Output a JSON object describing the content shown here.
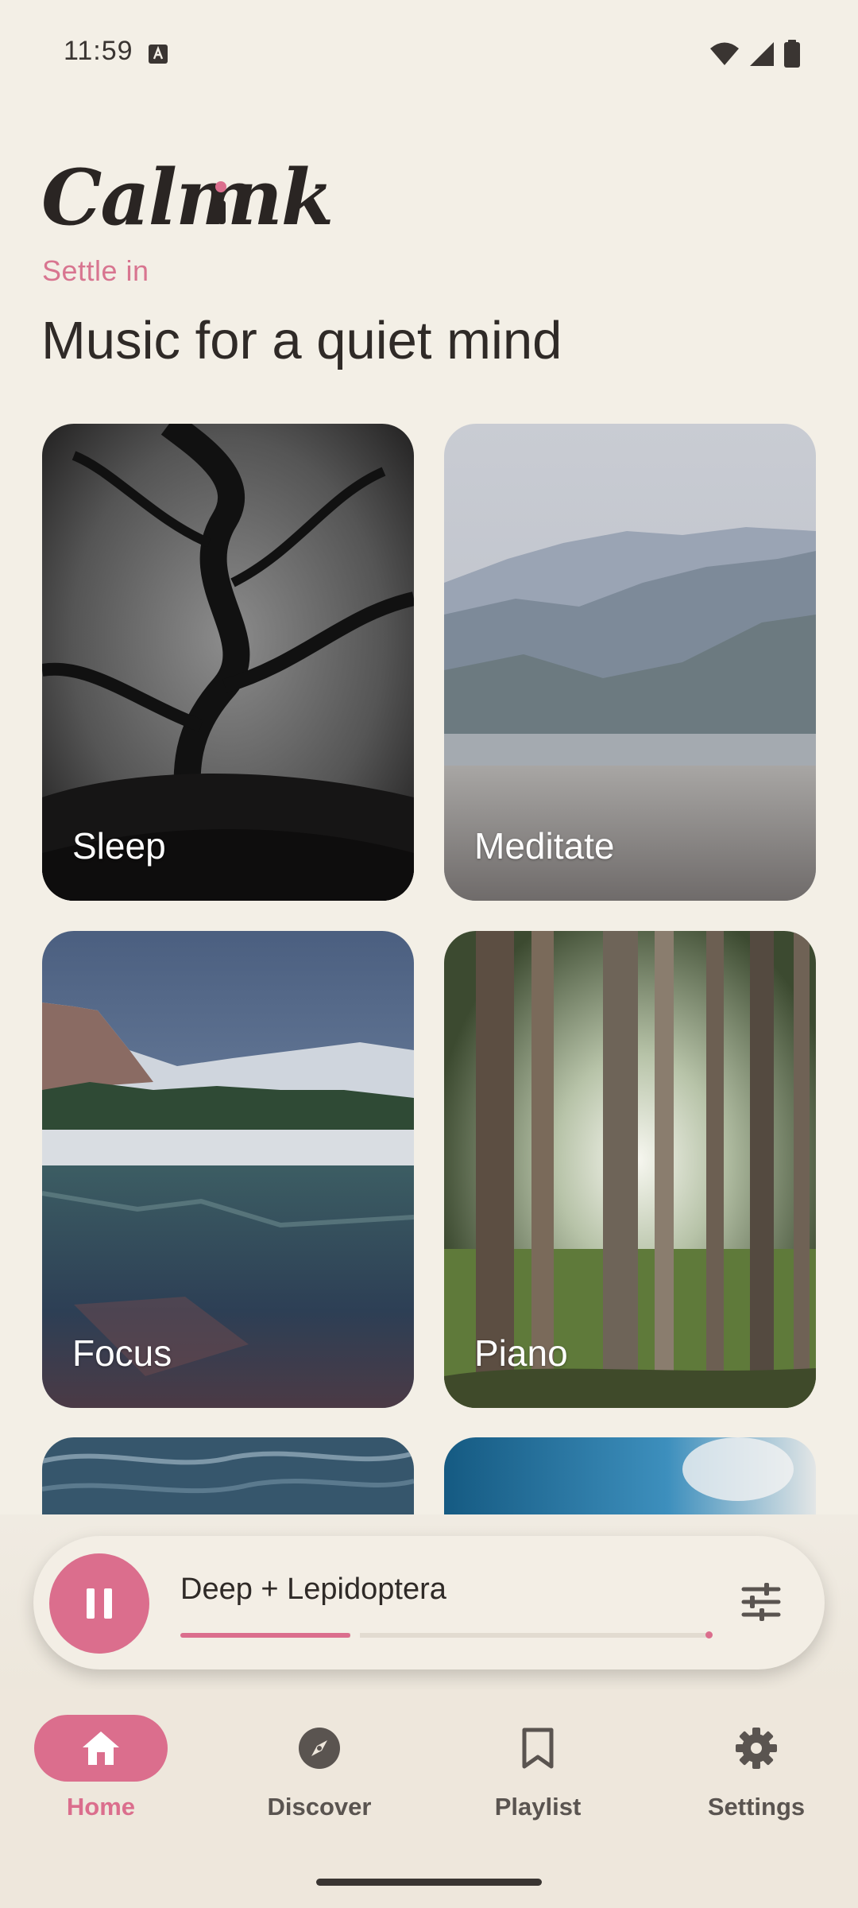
{
  "status_bar": {
    "time": "11:59",
    "icons": [
      "notification-a-icon",
      "wifi-icon",
      "signal-icon",
      "battery-icon"
    ]
  },
  "header": {
    "logo_text": "Calmink",
    "subtitle": "Settle in",
    "headline": "Music for a quiet mind"
  },
  "categories": [
    {
      "label": "Sleep"
    },
    {
      "label": "Meditate"
    },
    {
      "label": "Focus"
    },
    {
      "label": "Piano"
    }
  ],
  "player": {
    "track_title": "Deep + Lepidoptera",
    "progress_fraction": 0.32,
    "state": "playing",
    "controls": [
      "pause-icon",
      "equalizer-icon"
    ]
  },
  "bottom_nav": {
    "items": [
      {
        "label": "Home",
        "icon": "home-icon",
        "active": true
      },
      {
        "label": "Discover",
        "icon": "compass-icon",
        "active": false
      },
      {
        "label": "Playlist",
        "icon": "bookmark-icon",
        "active": false
      },
      {
        "label": "Settings",
        "icon": "gear-icon",
        "active": false
      }
    ]
  },
  "colors": {
    "accent": "#db6e8d",
    "background": "#f3efe6",
    "nav_background": "#eee7dc"
  }
}
